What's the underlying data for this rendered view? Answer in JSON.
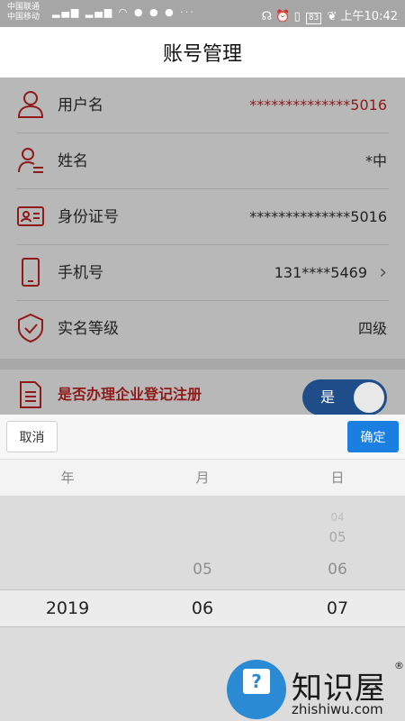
{
  "status_bar": {
    "carrier1": "中国联通",
    "carrier2": "中国移动",
    "battery": "83",
    "time": "上午10:42"
  },
  "header": {
    "title": "账号管理"
  },
  "account_rows": [
    {
      "label": "用户名",
      "value": "**************5016",
      "icon": "person-outline-icon"
    },
    {
      "label": "姓名",
      "value": "*中",
      "icon": "person-list-icon"
    },
    {
      "label": "身份证号",
      "value": "**************5016",
      "icon": "id-card-icon"
    },
    {
      "label": "手机号",
      "value": "131****5469",
      "icon": "phone-icon",
      "arrow": "›"
    },
    {
      "label": "实名等级",
      "value": "四级",
      "icon": "shield-check-icon"
    }
  ],
  "registration": {
    "label": "是否办理企业登记注册",
    "toggle_label": "是",
    "toggle_on": true
  },
  "picker": {
    "cancel_label": "取消",
    "confirm_label": "确定",
    "columns": [
      "年",
      "月",
      "日"
    ],
    "year": {
      "selected": "2019"
    },
    "month": {
      "above": [
        "05"
      ],
      "selected": "06"
    },
    "day": {
      "above": [
        "04",
        "05",
        "06"
      ],
      "selected": "07"
    }
  },
  "watermark": {
    "brand": "知识屋",
    "url": "zhishiwu.com"
  },
  "colors": {
    "accent_red": "#8e1a1a",
    "toggle_blue": "#1e4d8a",
    "confirm_blue": "#1a7fe0"
  }
}
